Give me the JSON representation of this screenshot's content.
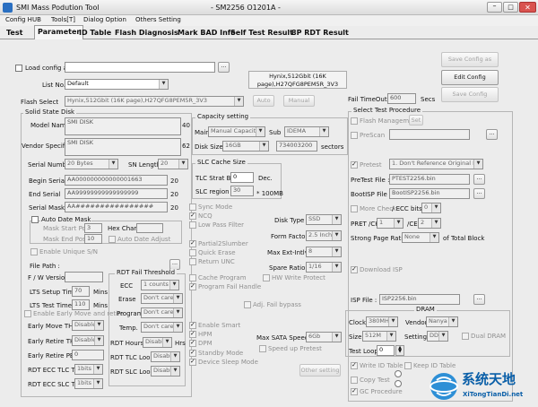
{
  "window": {
    "title": "SMI Mass Podution Tool",
    "version": "- SM2256 O1201A -"
  },
  "menu": [
    "Config HUB",
    "Tools[T]",
    "Dialog Option",
    "Others Setting"
  ],
  "tabs": [
    "Test",
    "Parameter",
    "ID Table",
    "Flash Diagnosis",
    "Mark BAD Info",
    "Self Test Result",
    "8P RDT Result"
  ],
  "top": {
    "load_config_label": "Load config as",
    "list_no_label": "List No.",
    "list_no_value": "Default",
    "flash_label": "Hynix,512Gbit (16K page),H27QFG8PEM5R_3V3",
    "flash_select_label": "Flash Select",
    "flash_select_value": "Hynix,512Gbit (16K page),H27QFG8PEM5R_3V3",
    "auto_button": "Auto",
    "manual_button": "Manual",
    "save_config_as_button": "Save Config as",
    "edit_config_button": "Edit Config",
    "save_config_button": "Save Config",
    "fail_timeout_label": "Fail TimeOut",
    "fail_timeout_value": "600",
    "secs_label": "Secs"
  },
  "ssd": {
    "group_title": "Solid State Disk",
    "model_label": "Model Name",
    "model_value": "SMI DISK",
    "model_len": "40",
    "vendor_label": "Vendor Specific",
    "vendor_value": "SMI DISK",
    "vendor_len": "62",
    "serial_label": "Serial Number",
    "serial_value": "20 Bytes",
    "sn_length_label": "SN Length",
    "sn_length_value": "20",
    "begin_serial_label": "Begin Serial",
    "begin_serial_value": "AA000000000000001663",
    "begin_len": "20",
    "end_serial_label": "End Serial",
    "end_serial_value": "AA99999999999999999",
    "end_len": "20",
    "serial_mask_label": "Serial Mask",
    "serial_mask_value": "AA################",
    "mask_len": "20",
    "auto_date_mask": "Auto Date Mask",
    "mask_start_pos": "Mask Start Pos",
    "mask_start_val": "3",
    "mask_end_pos": "Mask End Pos",
    "mask_end_val": "10",
    "hex_char": "Hex Char:",
    "auto_date_adjust": "Auto Date Adjust",
    "enable_unique_sn": "Enable Unique S/N",
    "file_path": "File Path :",
    "fw_version": "F / W Version",
    "lts_setup_time": "LTS Setup Time",
    "lts_setup_val": "70",
    "lts_test_time": "LTS Test Time",
    "lts_test_val": "110",
    "mins": "Mins",
    "enable_early": "Enable Early Move and retire",
    "early_move": "Early Move TH.",
    "early_move_val": "Disable",
    "early_retire": "Early Retire TH.",
    "early_retire_val": "Disable",
    "early_retire_pe": "Early Retire PE",
    "early_retire_pe_val": "0",
    "rdt_ecc_tlc": "RDT ECC TLC TH",
    "rdt_ecc_tlc_val": "1bits",
    "rdt_ecc_slc": "RDT ECC SLC TH",
    "rdt_ecc_slc_val": "1bits"
  },
  "rdt": {
    "title": "RDT Fail Threshold",
    "ecc": "ECC",
    "ecc_val": "1 counts",
    "erase": "Erase",
    "erase_val": "Don't care",
    "program": "Program",
    "program_val": "Don't care",
    "temp": "Temp.",
    "temp_val": "Don't care",
    "rdt_hours": "RDT Hours",
    "rdt_hours_val": "Disable",
    "hrs": "Hrs",
    "tlc_loops": "RDT TLC Loops",
    "tlc_loops_val": "Disable",
    "slc_loops": "RDT SLC Loops",
    "slc_loops_val": "Disable"
  },
  "capacity": {
    "title": "Capacity setting",
    "main": "Main",
    "main_val": "Manual Capacity",
    "sub": "Sub",
    "sub_val": "IDEMA",
    "disk_size": "Disk Size",
    "disk_size_val": "16GB",
    "sectors_val": "734003200",
    "sectors": "sectors"
  },
  "slc": {
    "title": "SLC Cache Size",
    "tlc_strat": "TLC Strat Bk",
    "tlc_strat_val": "0",
    "dec": "Dec.",
    "slc_region": "SLC region",
    "slc_region_val": "30",
    "unit": "* 100MB"
  },
  "mid": {
    "sync_mode": "Sync Mode",
    "ncq": "NCQ",
    "low_pass": "Low Pass Filter",
    "partial": "Partial2Slumber",
    "quick_erase": "Quick Erase",
    "return_unc": "Return UNC",
    "cache_program": "Cache Program",
    "program_fail": "Program Fail Handle",
    "hw_write": "HW Write Protect",
    "adj_fail": "Adj. Fail bypass",
    "enable_smart": "Enable Smart",
    "hpm": "HPM",
    "dpm": "DPM",
    "standby": "Standby Mode",
    "device_sleep": "Device Sleep Mode",
    "disk_type": "Disk Type",
    "disk_type_val": "SSD",
    "form_factor": "Form Factor",
    "form_factor_val": "2.5 Inch",
    "max_ext": "Max Ext-Intlv",
    "max_ext_val": "8",
    "spare_ratio": "Spare Ratio",
    "spare_ratio_val": "1/16",
    "max_sata": "Max SATA Speed",
    "max_sata_val": "6Gb",
    "speed_up": "Speed up Pretest",
    "other_setting": "Other setting"
  },
  "right": {
    "title": "Select Test Procedure",
    "flash_mgmt": "Flash Management",
    "set_btn": "Set",
    "prescan": "PreScan",
    "pretest": "Pretest",
    "pretest_val": "1. Don't Reference Original Bad",
    "pretest_file": "PreTest File :",
    "pretest_file_val": "PTEST2256.bin",
    "bootisp": "BootISP File :",
    "bootisp_val": "BootISP2256.bin",
    "more_check": "More Check",
    "ecc_bits": "/ ECC bits",
    "ecc_bits_val": "0",
    "pret_ch": "PRET /CH",
    "pret_ch_val": "1",
    "ce": "/CE",
    "ce_val": "2",
    "strong_page": "Strong Page Ratio :",
    "strong_page_val": "None",
    "of_total": "of Total Block",
    "download_isp": "Download ISP",
    "isp_file": "ISP File :",
    "isp_file_val": "ISP2256.bin",
    "dram": "DRAM",
    "clock": "Clock",
    "clock_val": "380MHZ",
    "vendor": "Vendor",
    "vendor_val": "Nanya",
    "size": "Size",
    "size_val": "512M",
    "setting": "Setting",
    "setting_val": "DDR3",
    "dual_dram": "Dual DRAM",
    "test_loop": "Test Loop",
    "test_loop_val": "0",
    "write_id": "Write ID Table",
    "keep_id": "Keep ID Table",
    "copy_test": "Copy Test",
    "gc_procedure": "GC Procedure"
  },
  "watermark": {
    "text": "系统天地",
    "sub": "XiTongTianDi.net"
  },
  "colors": {
    "accent": "#0a5fa8",
    "window": "#ececec"
  }
}
